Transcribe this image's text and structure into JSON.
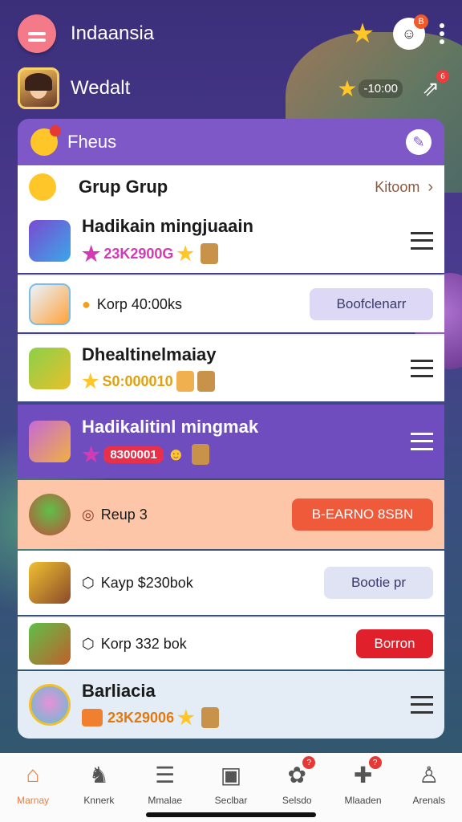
{
  "header": {
    "title": "Indaansia",
    "face_badge": "B",
    "icons": [
      "menu-icon",
      "star-icon",
      "face-icon",
      "kebab-icon"
    ]
  },
  "user": {
    "name": "Wedalt",
    "coins": "-10:00",
    "share_badge": "6"
  },
  "panel": {
    "title": "Fheus",
    "rows": [
      {
        "title": "Grup Grup",
        "action": "Kitoom"
      },
      {
        "title": "Hadikain mingjuaain",
        "value": "23K2900G"
      },
      {
        "sub": "Korp 40:00ks",
        "button": "Boofclenarr"
      },
      {
        "title": "Dhealtinelmaiay",
        "value": "S0:000010"
      },
      {
        "title": "Hadikalitinl mingmak",
        "value": "8300001"
      },
      {
        "sub": "Reup 3",
        "button": "B-EARNO 8SBN"
      },
      {
        "sub": "Kayp $230bok",
        "button": "Bootie pr"
      },
      {
        "sub": "Korp 332 bok",
        "button": "Borron"
      },
      {
        "title": "Barliacia",
        "value": "23K29006"
      }
    ]
  },
  "nav": [
    {
      "label": "Marnay",
      "icon": "home-icon"
    },
    {
      "label": "Knnerk",
      "icon": "cow-icon"
    },
    {
      "label": "Mmalae",
      "icon": "database-icon"
    },
    {
      "label": "Seclbar",
      "icon": "box-icon"
    },
    {
      "label": "Selsdo",
      "icon": "cookie-icon",
      "badge": "?"
    },
    {
      "label": "Mlaaden",
      "icon": "puzzle-icon",
      "badge": "?"
    },
    {
      "label": "Arenals",
      "icon": "user-icon"
    }
  ],
  "colors": {
    "accent": "#7e58c6",
    "orange": "#ef7a3a",
    "menu": "#f47a8a"
  }
}
